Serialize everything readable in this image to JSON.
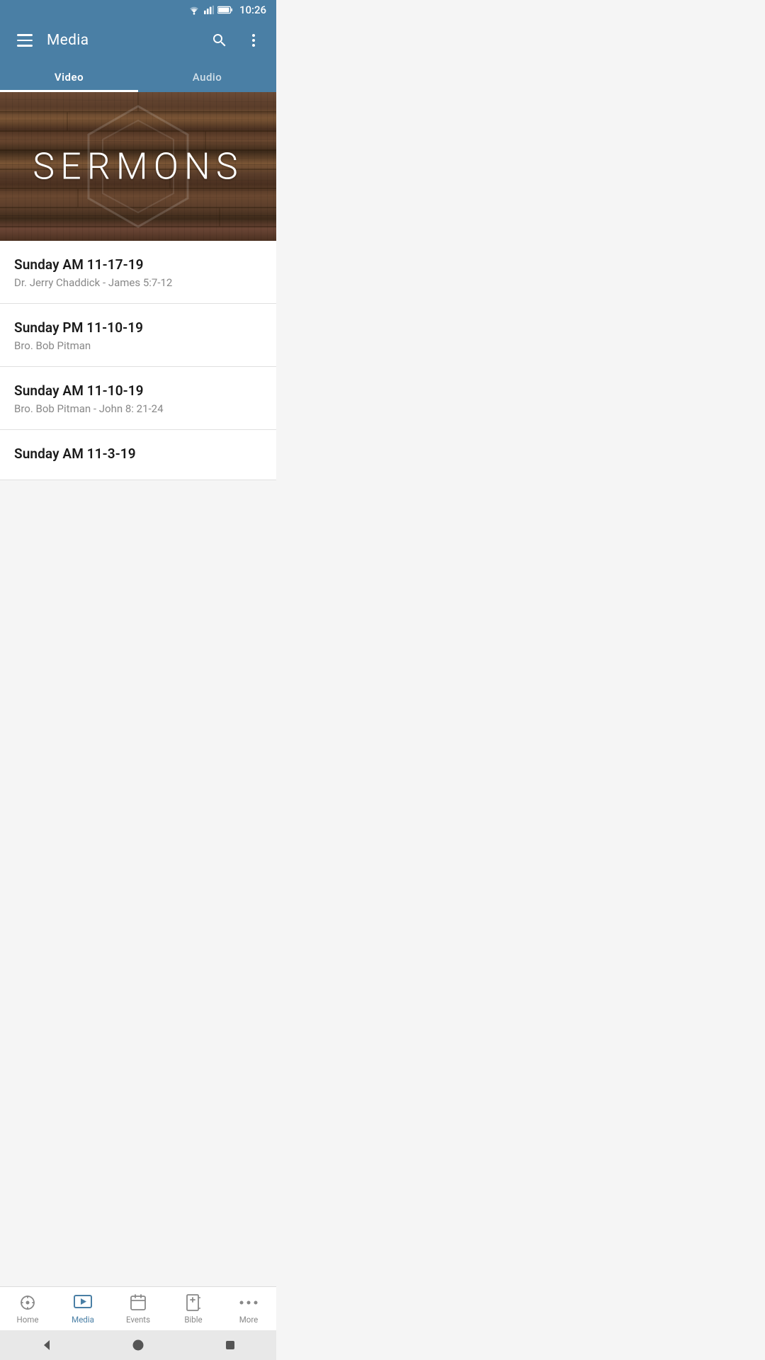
{
  "statusBar": {
    "time": "10:26"
  },
  "appBar": {
    "title": "Media",
    "menuIcon": "menu-icon",
    "searchIcon": "search-icon",
    "moreIcon": "more-vert-icon"
  },
  "tabs": [
    {
      "id": "video",
      "label": "Video",
      "active": true
    },
    {
      "id": "audio",
      "label": "Audio",
      "active": false
    }
  ],
  "banner": {
    "text": "SERMONS"
  },
  "sermons": [
    {
      "title": "Sunday AM 11-17-19",
      "subtitle": "Dr. Jerry Chaddick - James 5:7-12"
    },
    {
      "title": "Sunday PM 11-10-19",
      "subtitle": "Bro. Bob Pitman"
    },
    {
      "title": "Sunday AM 11-10-19",
      "subtitle": "Bro. Bob Pitman -  John 8: 21-24"
    },
    {
      "title": "Sunday AM 11-3-19",
      "subtitle": ""
    }
  ],
  "bottomNav": [
    {
      "id": "home",
      "label": "Home",
      "active": false,
      "icon": "home-nav-icon"
    },
    {
      "id": "media",
      "label": "Media",
      "active": true,
      "icon": "media-nav-icon"
    },
    {
      "id": "events",
      "label": "Events",
      "active": false,
      "icon": "events-nav-icon"
    },
    {
      "id": "bible",
      "label": "Bible",
      "active": false,
      "icon": "bible-nav-icon"
    },
    {
      "id": "more",
      "label": "More",
      "active": false,
      "icon": "more-nav-icon"
    }
  ],
  "sysNav": {
    "backIcon": "back-icon",
    "homeIcon": "circle-icon",
    "recentIcon": "square-icon"
  }
}
